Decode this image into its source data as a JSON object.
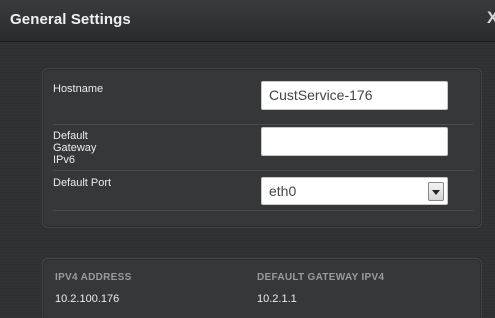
{
  "dialog": {
    "title": "General Settings",
    "close_glyph": "X"
  },
  "form": {
    "hostname": {
      "label": "Hostname",
      "value": "CustService-176"
    },
    "default_gateway_ipv6": {
      "label_lines": [
        "Default",
        "Gateway",
        "IPv6"
      ],
      "value": ""
    },
    "default_port": {
      "label": "Default Port",
      "selected": "eth0"
    }
  },
  "table": {
    "columns": [
      "IPV4 ADDRESS",
      "DEFAULT GATEWAY IPV4"
    ],
    "rows": [
      [
        "10.2.100.176",
        "10.2.1.1"
      ]
    ]
  },
  "icons": {
    "close": "close-icon",
    "dropdown": "chevron-down-icon"
  }
}
